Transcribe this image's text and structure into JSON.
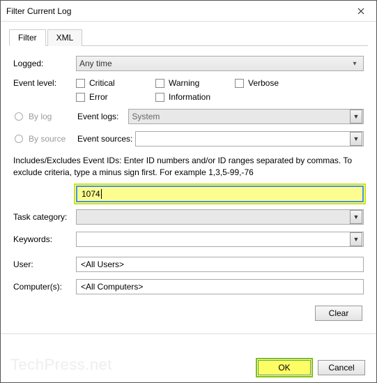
{
  "window": {
    "title": "Filter Current Log"
  },
  "tabs": {
    "filter": "Filter",
    "xml": "XML"
  },
  "labels": {
    "logged": "Logged:",
    "event_level": "Event level:",
    "by_log": "By log",
    "by_source": "By source",
    "event_logs": "Event logs:",
    "event_sources": "Event sources:",
    "task_category": "Task category:",
    "keywords": "Keywords:",
    "user": "User:",
    "computers": "Computer(s):"
  },
  "logged_value": "Any time",
  "levels": {
    "critical": "Critical",
    "warning": "Warning",
    "verbose": "Verbose",
    "error": "Error",
    "information": "Information"
  },
  "event_logs_value": "System",
  "event_sources_value": "",
  "help_text": "Includes/Excludes Event IDs: Enter ID numbers and/or ID ranges separated by commas. To exclude criteria, type a minus sign first. For example 1,3,5-99,-76",
  "event_id_value": "1074",
  "task_category_value": "",
  "keywords_value": "",
  "user_value": "<All Users>",
  "computers_value": "<All Computers>",
  "buttons": {
    "clear": "Clear",
    "ok": "OK",
    "cancel": "Cancel"
  },
  "watermark": "TechPress.net"
}
